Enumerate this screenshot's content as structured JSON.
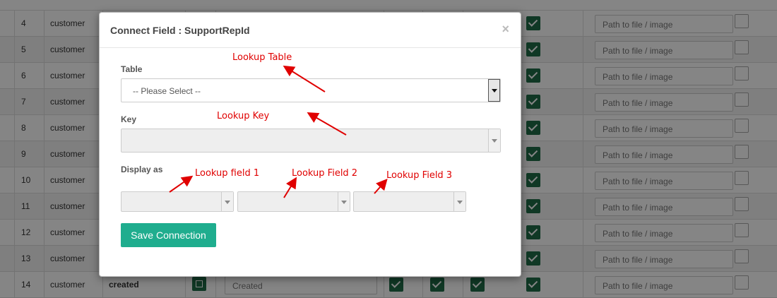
{
  "background_table": {
    "rows": [
      {
        "num": "4",
        "entity": "customer",
        "path_placeholder": "Path to file / image"
      },
      {
        "num": "5",
        "entity": "customer",
        "path_placeholder": "Path to file / image"
      },
      {
        "num": "6",
        "entity": "customer",
        "path_placeholder": "Path to file / image"
      },
      {
        "num": "7",
        "entity": "customer",
        "path_placeholder": "Path to file / image"
      },
      {
        "num": "8",
        "entity": "customer",
        "path_placeholder": "Path to file / image"
      },
      {
        "num": "9",
        "entity": "customer",
        "path_placeholder": "Path to file / image"
      },
      {
        "num": "10",
        "entity": "customer",
        "path_placeholder": "Path to file / image"
      },
      {
        "num": "11",
        "entity": "customer",
        "path_placeholder": "Path to file / image"
      },
      {
        "num": "12",
        "entity": "customer",
        "path_placeholder": "Path to file / image"
      },
      {
        "num": "13",
        "entity": "customer",
        "path_placeholder": "Path to file / image"
      },
      {
        "num": "14",
        "entity": "customer",
        "path_placeholder": "Path to file / image",
        "field_name": "created",
        "field_label": "Created"
      }
    ],
    "colors": {
      "check": "#1f6b48"
    }
  },
  "modal": {
    "title": "Connect Field : SupportRepId",
    "close": "×",
    "table_label": "Table",
    "table_select_value": "-- Please Select --",
    "key_label": "Key",
    "display_label": "Display as",
    "save_button": "Save Connection"
  },
  "annotations": {
    "lookup_table": "Lookup Table",
    "lookup_key": "Lookup Key",
    "lookup_field_1": "Lookup field 1",
    "lookup_field_2": "Lookup Field 2",
    "lookup_field_3": "Lookup Field 3"
  },
  "colors": {
    "accent": "#1fad8e",
    "annotation": "#e00000"
  }
}
